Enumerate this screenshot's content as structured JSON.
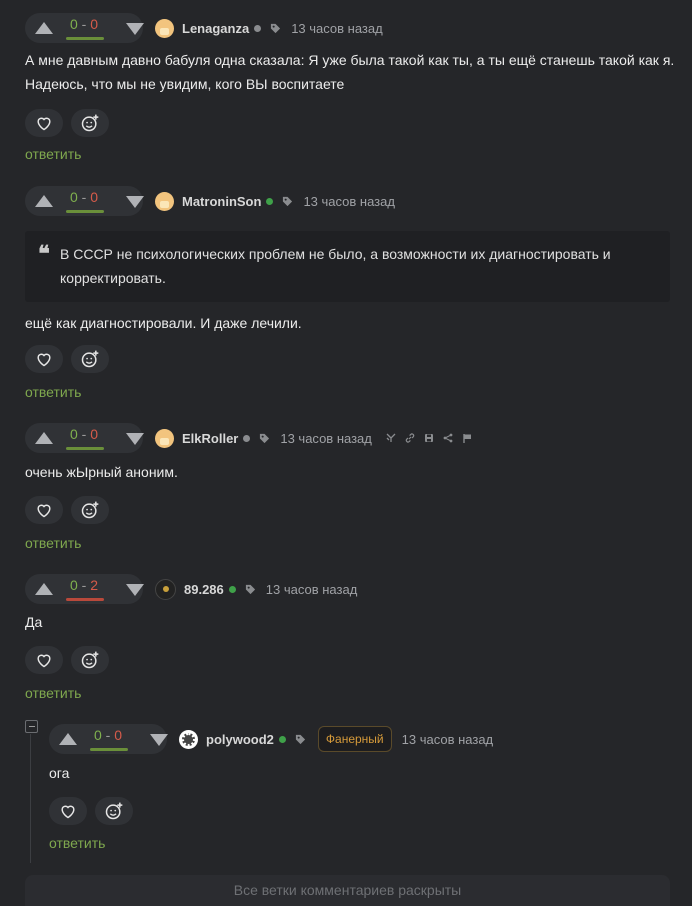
{
  "comments": [
    {
      "username": "Lenaganza",
      "online": false,
      "score_pos": "0",
      "score_neg": "0",
      "time": "13 часов назад",
      "text": "А мне давным давно бабуля одна сказала: Я уже была такой как ты, а ты ещё станешь такой как я. Надеюсь, что мы не увидим, кого ВЫ воспитаете",
      "reply_label": "ответить"
    },
    {
      "username": "MatroninSon",
      "online": true,
      "score_pos": "0",
      "score_neg": "0",
      "time": "13 часов назад",
      "quote": "В СССР не психологических проблем не было, а возможности их диагностировать и корректировать.",
      "text": "ещё как диагностировали. И даже лечили.",
      "reply_label": "ответить"
    },
    {
      "username": "ElkRoller",
      "online": false,
      "score_pos": "0",
      "score_neg": "0",
      "time": "13 часов назад",
      "text": "очень жЫрный аноним.",
      "reply_label": "ответить"
    },
    {
      "username": "89.286",
      "online": true,
      "score_pos": "0",
      "score_neg": "2",
      "time": "13 часов назад",
      "text": "Да",
      "reply_label": "ответить"
    },
    {
      "username": "polywood2",
      "online": true,
      "score_pos": "0",
      "score_neg": "0",
      "badge": "Фанерный",
      "time": "13 часов назад",
      "text": "ога",
      "reply_label": "ответить"
    }
  ],
  "footer": {
    "label": "Все ветки комментариев раскрыты"
  },
  "colors": {
    "background": "#252629",
    "positive": "#7fb04e",
    "negative": "#d65b4a",
    "reply_link": "#7fa84e",
    "online": "#3fa149",
    "badge": "#d59a3a"
  },
  "icons": [
    "arrow-up-icon",
    "arrow-down-icon",
    "heart-icon",
    "emoji-add-icon",
    "tag-icon",
    "quote-icon",
    "thread-icon",
    "link-icon",
    "save-icon",
    "share-icon",
    "flag-icon"
  ]
}
